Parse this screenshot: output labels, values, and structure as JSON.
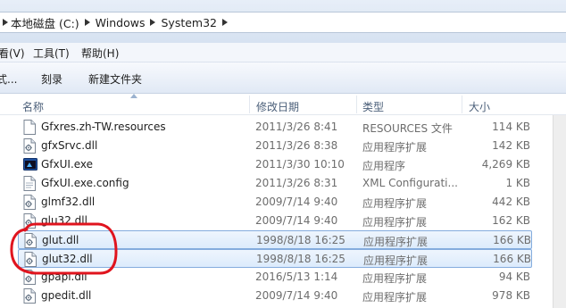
{
  "address_bar": {
    "crumbs": [
      "本地磁盘 (C:)",
      "Windows",
      "System32"
    ]
  },
  "menu": {
    "items": [
      "看(V)",
      "工具(T)",
      "帮助(H)"
    ]
  },
  "toolbar": {
    "items": [
      "式...",
      "刻录",
      "新建文件夹"
    ]
  },
  "columns": {
    "name": "名称",
    "date": "修改日期",
    "type": "类型",
    "size": "大小"
  },
  "files": [
    {
      "name": "Gfxres.zh-TW.resources",
      "date": "2011/3/26 8:41",
      "type": "RESOURCES 文件",
      "size": "114 KB",
      "icon": "file-icon",
      "selected": false
    },
    {
      "name": "gfxSrvc.dll",
      "date": "2011/3/26 8:38",
      "type": "应用程序扩展",
      "size": "142 KB",
      "icon": "dll-icon",
      "selected": false
    },
    {
      "name": "GfxUI.exe",
      "date": "2011/3/30 10:10",
      "type": "应用程序",
      "size": "4,269 KB",
      "icon": "exe-icon",
      "selected": false
    },
    {
      "name": "GfxUI.exe.config",
      "date": "2011/3/26 8:31",
      "type": "XML Configurati...",
      "size": "1 KB",
      "icon": "config-icon",
      "selected": false
    },
    {
      "name": "glmf32.dll",
      "date": "2009/7/14 9:40",
      "type": "应用程序扩展",
      "size": "442 KB",
      "icon": "dll-icon",
      "selected": false
    },
    {
      "name": "glu32.dll",
      "date": "2009/7/14 9:40",
      "type": "应用程序扩展",
      "size": "162 KB",
      "icon": "dll-icon",
      "selected": false
    },
    {
      "name": "glut.dll",
      "date": "1998/8/18 16:25",
      "type": "应用程序扩展",
      "size": "166 KB",
      "icon": "dll-icon",
      "selected": true
    },
    {
      "name": "glut32.dll",
      "date": "1998/8/18 16:25",
      "type": "应用程序扩展",
      "size": "166 KB",
      "icon": "dll-icon",
      "selected": true
    },
    {
      "name": "gpapi.dll",
      "date": "2016/5/13 1:14",
      "type": "应用程序扩展",
      "size": "94 KB",
      "icon": "dll-icon",
      "selected": false
    },
    {
      "name": "gpedit.dll",
      "date": "2009/7/14 9:40",
      "type": "应用程序扩展",
      "size": "978 KB",
      "icon": "dll-icon",
      "selected": false
    }
  ],
  "colors": {
    "selection_border": "#84acdd",
    "annotation_red": "#e0141e"
  }
}
